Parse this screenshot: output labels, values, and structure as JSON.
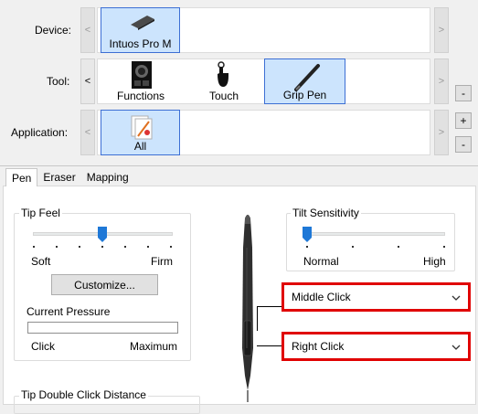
{
  "device_row": {
    "label": "Device:",
    "items": [
      {
        "label": "Intuos Pro M",
        "selected": true,
        "icon": "tablet-icon"
      }
    ]
  },
  "tool_row": {
    "label": "Tool:",
    "items": [
      {
        "label": "Functions",
        "selected": false,
        "icon": "functions-icon"
      },
      {
        "label": "Touch",
        "selected": false,
        "icon": "touch-hand-icon"
      },
      {
        "label": "Grip Pen",
        "selected": true,
        "icon": "pen-icon"
      }
    ]
  },
  "application_row": {
    "label": "Application:",
    "items": [
      {
        "label": "All",
        "selected": true,
        "icon": "all-apps-icon"
      }
    ],
    "add_label": "+",
    "remove_label": "-"
  },
  "scroll_left": "<",
  "scroll_right": ">",
  "tabs": [
    {
      "label": "Pen",
      "active": true
    },
    {
      "label": "Eraser",
      "active": false
    },
    {
      "label": "Mapping",
      "active": false
    }
  ],
  "tip_feel": {
    "title": "Tip Feel",
    "soft_label": "Soft",
    "firm_label": "Firm",
    "slider_position": 0.5,
    "customize_label": "Customize...",
    "current_pressure_label": "Current Pressure",
    "click_label": "Click",
    "maximum_label": "Maximum"
  },
  "tilt": {
    "title": "Tilt Sensitivity",
    "normal_label": "Normal",
    "high_label": "High",
    "slider_position": 0.0
  },
  "upper_button": {
    "value": "Middle Click"
  },
  "lower_button": {
    "value": "Right Click"
  },
  "tip_double_click": {
    "title": "Tip Double Click Distance"
  },
  "colors": {
    "highlight": "#e00000",
    "selected_tile": "#cce4fd",
    "slider_thumb": "#1e78d7"
  }
}
